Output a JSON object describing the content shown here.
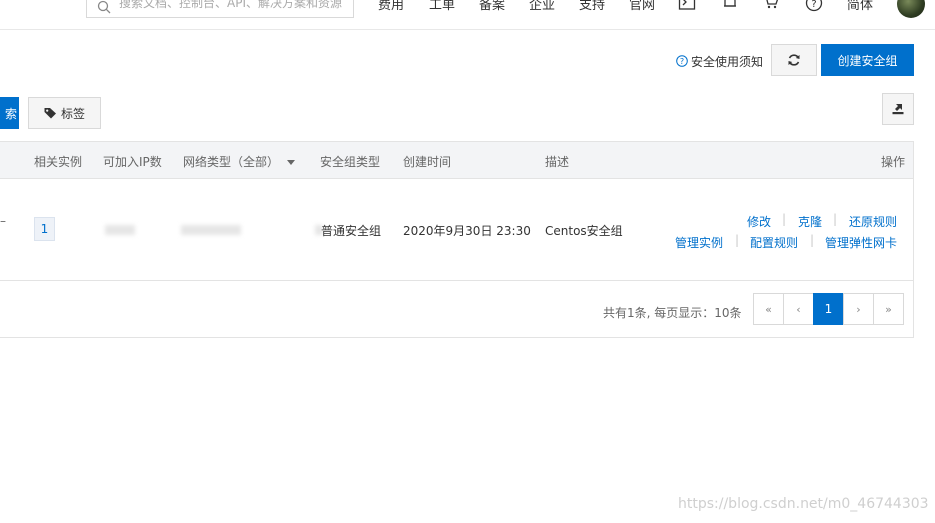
{
  "topbar": {
    "search_placeholder": "搜索文档、控制台、API、解决方案和资源",
    "nav": [
      "费用",
      "工单",
      "备案",
      "企业",
      "支持",
      "官网"
    ],
    "lang": "简体",
    "icons": [
      "terminal-icon",
      "bell-icon",
      "cart-icon",
      "help-icon"
    ]
  },
  "actions": {
    "notice": "安全使用须知",
    "create": "创建安全组",
    "partial_left": "索",
    "tag": "标签"
  },
  "table": {
    "headers": {
      "instances": "相关实例",
      "ip_count": "可加入IP数",
      "network_type": "网络类型（全部）",
      "group_type": "安全组类型",
      "created": "创建时间",
      "desc": "描述",
      "ops": "操作"
    },
    "row": {
      "instances": "1",
      "group_type": "普通安全组",
      "created": "2020年9月30日 23:30",
      "desc": "Centos安全组",
      "links": [
        "修改",
        "克隆",
        "还原规则",
        "管理实例",
        "配置规则",
        "管理弹性网卡"
      ]
    }
  },
  "pagination": {
    "total": "共有1条, 每页显示：10条",
    "first": "«",
    "prev": "‹",
    "current": "1",
    "next": "›",
    "last": "»"
  },
  "watermark": "https://blog.csdn.net/m0_46744303",
  "colors": {
    "primary": "#0070cc",
    "header_bg": "#f3f4f6"
  }
}
